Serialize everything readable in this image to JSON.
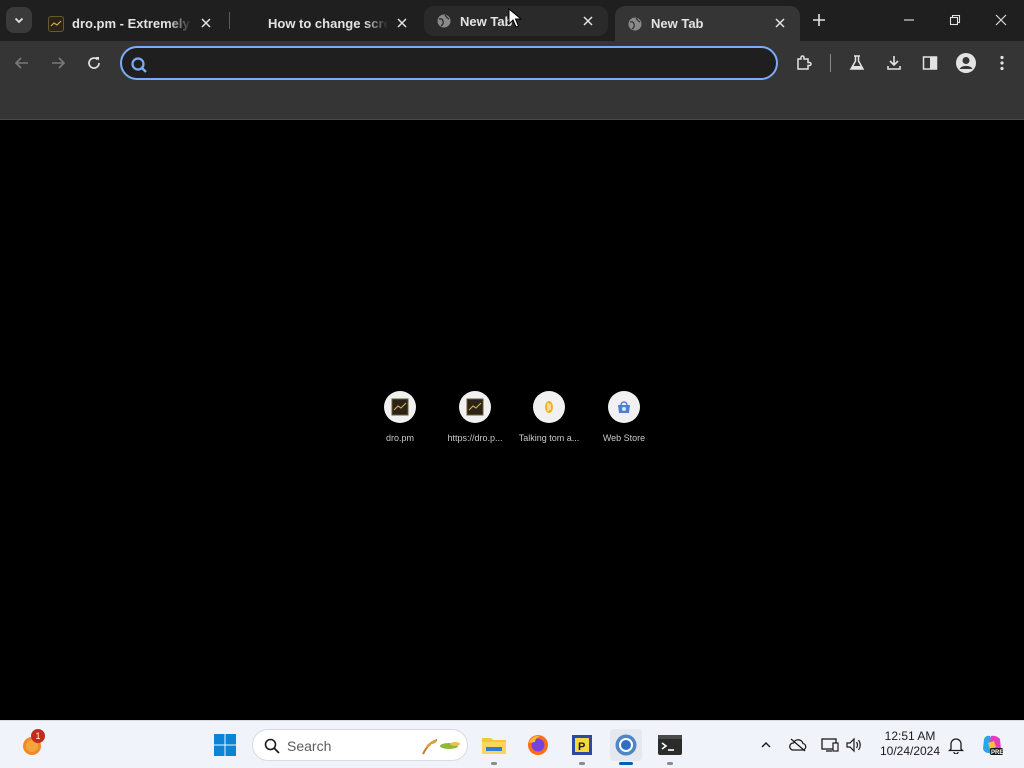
{
  "browser": {
    "tabs": [
      {
        "title": "dro.pm - Extremely Sh",
        "favicon": "dro-pm-favicon"
      },
      {
        "title": "How to change screen",
        "favicon": "none"
      },
      {
        "title": "New Tab",
        "favicon": "globe-icon"
      },
      {
        "title": "New Tab",
        "favicon": "globe-icon",
        "active": true
      }
    ],
    "omnibox": {
      "value": "",
      "placeholder": ""
    }
  },
  "ntp": {
    "shortcuts": [
      {
        "label": "dro.pm",
        "icon": "dro-pm-favicon"
      },
      {
        "label": "https://dro.p...",
        "icon": "dro-pm-favicon"
      },
      {
        "label": "Talking tom a...",
        "icon": "talking-tom-icon"
      },
      {
        "label": "Web Store",
        "icon": "web-store-icon"
      }
    ]
  },
  "taskbar": {
    "widgets_badge": "1",
    "search_placeholder": "Search",
    "clock_time": "12:51 AM",
    "clock_date": "10/24/2024"
  },
  "colors": {
    "focus_ring": "#7cacf8",
    "taskbar_active": "#005fb8",
    "badge": "#c42b1c"
  }
}
